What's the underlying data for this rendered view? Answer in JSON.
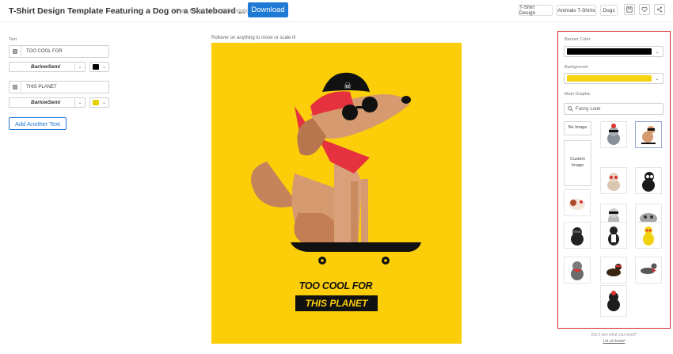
{
  "header": {
    "title": "T-Shirt Design Template Featuring a Dog on a Skateboard ...",
    "free_note": "Free Using Your Subscription!",
    "download_label": "Download",
    "tags": [
      "T-Shirt Design",
      "Animals T-Shirts",
      "Dogs"
    ],
    "actions": [
      "save-icon",
      "heart-icon",
      "share-icon"
    ]
  },
  "left_panel": {
    "section_label": "Text",
    "text_fields": [
      {
        "value": "TOO COOL FOR",
        "checked": true,
        "font": "BarlowSemi",
        "color": "#000000"
      },
      {
        "value": "THIS PLANET",
        "checked": true,
        "font": "BarlowSemi",
        "color": "#e6d000"
      }
    ],
    "add_text_label": "Add Another Text"
  },
  "canvas": {
    "hint": "Rollover on anything to move or scale it!",
    "background": "#fcce09",
    "line1": "TOO COOL FOR",
    "line2": "THIS PLANET"
  },
  "right_panel": {
    "banner_color_label": "Banner Color",
    "banner_color": "#000000",
    "background_label": "Background",
    "background_color": "#fcce09",
    "main_graphic_label": "Main Graphic",
    "search_value": "Funny Look",
    "no_image_label": "No Image",
    "custom_image_label": "Custom Image",
    "thumbnails": [
      "husky-dog-icon",
      "skateboard-dog-icon",
      "siamese-cat-icon",
      "black-cat-icon",
      "guinea-pig-icon",
      "schnauzer-dog-icon",
      "pug-icon",
      "black-cat-sunglasses-icon",
      "border-collie-icon",
      "duck-raincoat-icon",
      "gray-cat-icon",
      "dachshund-icon",
      "greyhound-icon",
      "black-pug-icon"
    ],
    "help_text": "Don't see what you need?",
    "help_link": "Let us know!"
  }
}
